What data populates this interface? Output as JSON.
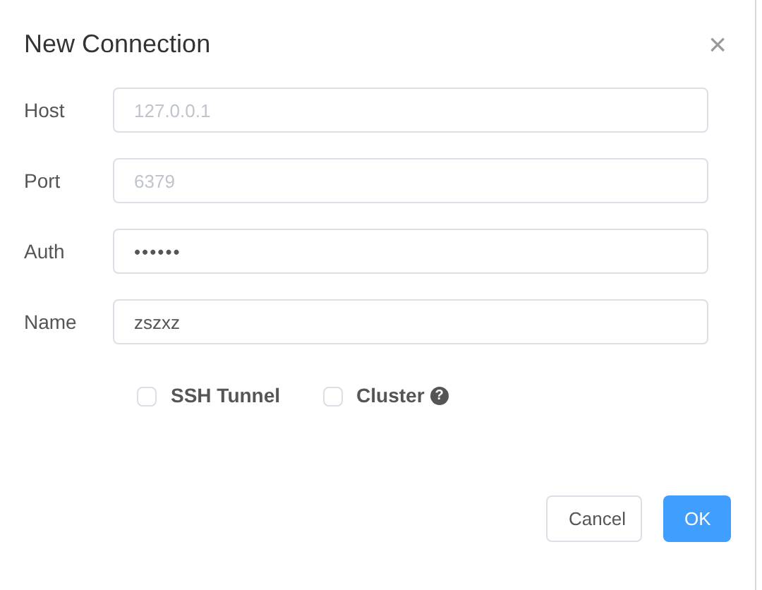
{
  "dialog": {
    "title": "New Connection",
    "close": "×"
  },
  "fields": [
    {
      "label": "Host",
      "placeholder": "127.0.0.1",
      "kind": "text"
    },
    {
      "label": "Port",
      "placeholder": "6379",
      "kind": "text"
    },
    {
      "label": "Auth",
      "value": "••••••",
      "kind": "password"
    },
    {
      "label": "Name",
      "value": "zszxz",
      "kind": "text"
    }
  ],
  "options": [
    {
      "label": "SSH Tunnel",
      "checked": false,
      "help": false
    },
    {
      "label": "Cluster",
      "checked": false,
      "help": true
    }
  ],
  "help_icon": "?",
  "buttons": [
    {
      "label": "Cancel",
      "kind": "secondary"
    },
    {
      "label": "OK",
      "kind": "primary"
    }
  ]
}
